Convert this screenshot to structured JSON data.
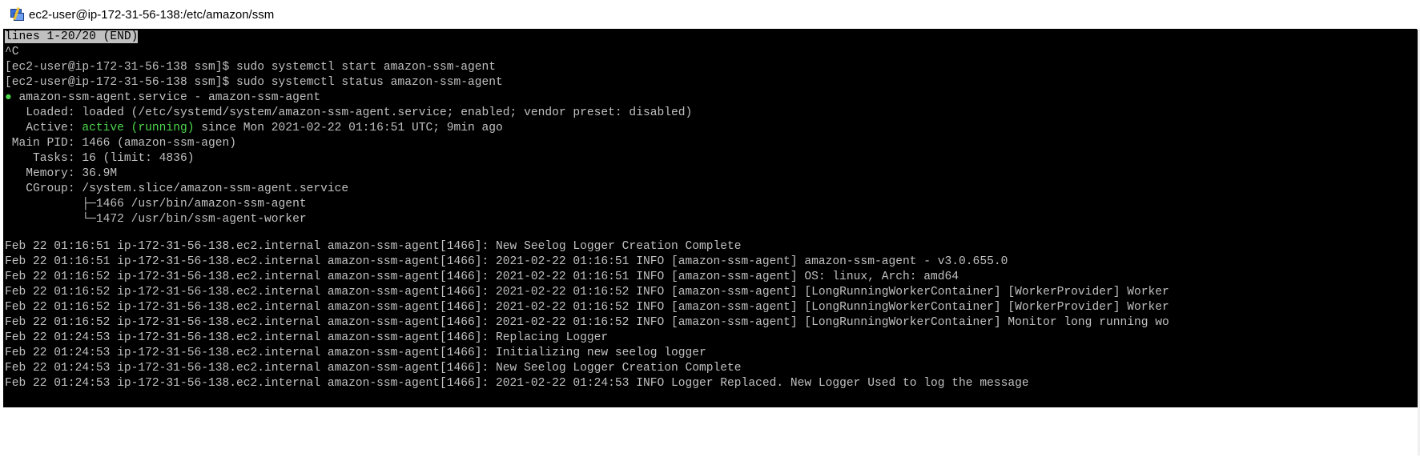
{
  "window": {
    "title": "ec2-user@ip-172-31-56-138:/etc/amazon/ssm",
    "icon": "putty-icon"
  },
  "terminal": {
    "pager_status": "lines 1-20/20 (END)",
    "lines": [
      "^C",
      "[ec2-user@ip-172-31-56-138 ssm]$ sudo systemctl start amazon-ssm-agent",
      "[ec2-user@ip-172-31-56-138 ssm]$ sudo systemctl status amazon-ssm-agent"
    ],
    "service": {
      "bullet": "●",
      "header": " amazon-ssm-agent.service - amazon-ssm-agent",
      "loaded": "   Loaded: loaded (/etc/systemd/system/amazon-ssm-agent.service; enabled; vendor preset: disabled)",
      "active_label": "   Active: ",
      "active_state": "active (running)",
      "active_rest": " since Mon 2021-02-22 01:16:51 UTC; 9min ago",
      "main_pid": " Main PID: 1466 (amazon-ssm-agen)",
      "tasks": "    Tasks: 16 (limit: 4836)",
      "memory": "   Memory: 36.9M",
      "cgroup": "   CGroup: /system.slice/amazon-ssm-agent.service",
      "cgroup_child1": "           ├─1466 /usr/bin/amazon-ssm-agent",
      "cgroup_child2": "           └─1472 /usr/bin/ssm-agent-worker"
    },
    "log": [
      "Feb 22 01:16:51 ip-172-31-56-138.ec2.internal amazon-ssm-agent[1466]: New Seelog Logger Creation Complete",
      "Feb 22 01:16:51 ip-172-31-56-138.ec2.internal amazon-ssm-agent[1466]: 2021-02-22 01:16:51 INFO [amazon-ssm-agent] amazon-ssm-agent - v3.0.655.0",
      "Feb 22 01:16:52 ip-172-31-56-138.ec2.internal amazon-ssm-agent[1466]: 2021-02-22 01:16:51 INFO [amazon-ssm-agent] OS: linux, Arch: amd64",
      "Feb 22 01:16:52 ip-172-31-56-138.ec2.internal amazon-ssm-agent[1466]: 2021-02-22 01:16:52 INFO [amazon-ssm-agent] [LongRunningWorkerContainer] [WorkerProvider] Worker",
      "Feb 22 01:16:52 ip-172-31-56-138.ec2.internal amazon-ssm-agent[1466]: 2021-02-22 01:16:52 INFO [amazon-ssm-agent] [LongRunningWorkerContainer] [WorkerProvider] Worker",
      "Feb 22 01:16:52 ip-172-31-56-138.ec2.internal amazon-ssm-agent[1466]: 2021-02-22 01:16:52 INFO [amazon-ssm-agent] [LongRunningWorkerContainer] Monitor long running wo",
      "Feb 22 01:24:53 ip-172-31-56-138.ec2.internal amazon-ssm-agent[1466]: Replacing Logger",
      "Feb 22 01:24:53 ip-172-31-56-138.ec2.internal amazon-ssm-agent[1466]: Initializing new seelog logger",
      "Feb 22 01:24:53 ip-172-31-56-138.ec2.internal amazon-ssm-agent[1466]: New Seelog Logger Creation Complete",
      "Feb 22 01:24:53 ip-172-31-56-138.ec2.internal amazon-ssm-agent[1466]: 2021-02-22 01:24:53 INFO Logger Replaced. New Logger Used to log the message"
    ]
  },
  "colors": {
    "terminal_bg": "#000000",
    "terminal_fg": "#c0c0c0",
    "active_green": "#4dd64d",
    "pager_bg": "#c0c0c0"
  }
}
